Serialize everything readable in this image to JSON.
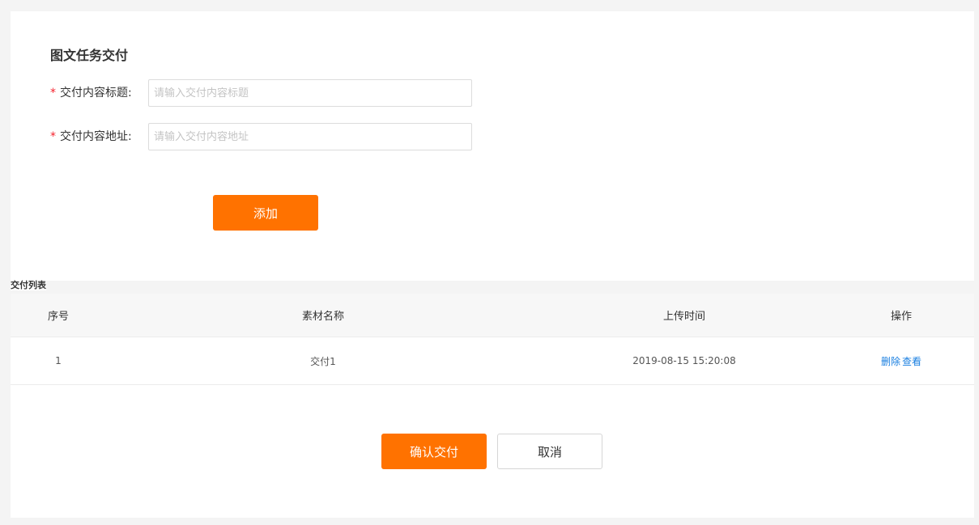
{
  "page": {
    "title": "图文任务交付"
  },
  "form": {
    "title_field": {
      "required_mark": "*",
      "label": "交付内容标题:",
      "value": "",
      "placeholder": "请输入交付内容标题"
    },
    "url_field": {
      "required_mark": "*",
      "label": "交付内容地址:",
      "value": "",
      "placeholder": "请输入交付内容地址"
    },
    "add_label": "添加"
  },
  "list": {
    "title": "交付列表",
    "columns": [
      "序号",
      "素材名称",
      "上传时间",
      "操作"
    ],
    "rows": [
      {
        "index": "1",
        "name": "交付1",
        "uploaded_at": "2019-08-15 15:20:08",
        "delete_label": "删除",
        "view_label": "查看"
      }
    ]
  },
  "footer": {
    "confirm_label": "确认交付",
    "cancel_label": "取消"
  },
  "colors": {
    "accent": "#ff7200",
    "link": "#1a7fe0",
    "required": "#f5222d"
  }
}
